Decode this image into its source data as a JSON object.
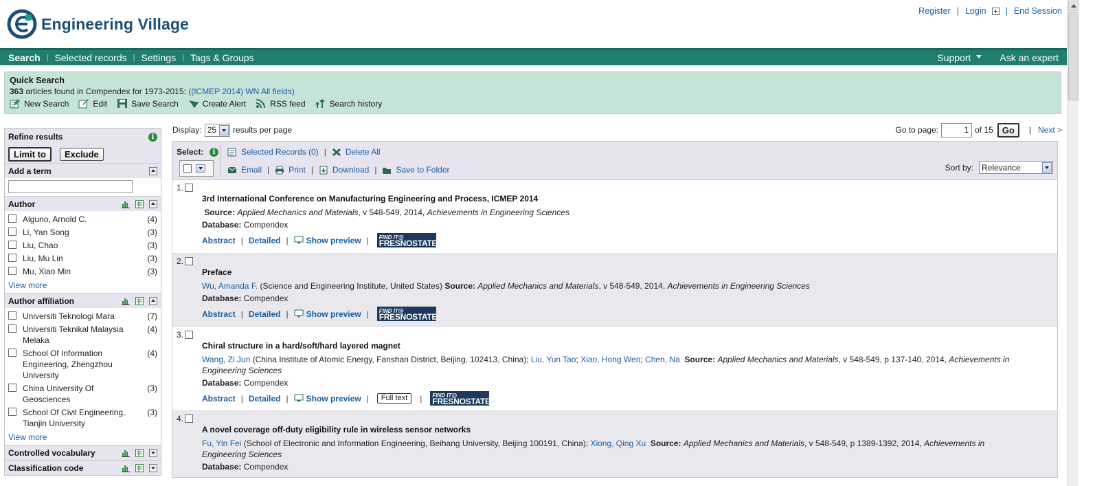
{
  "brand": {
    "name": "Engineering Village",
    "color": "#1c4f78",
    "nav_color": "#1f7e6e"
  },
  "top_links": {
    "register": "Register",
    "login": "Login",
    "end_session": "End Session"
  },
  "nav": {
    "items": [
      "Search",
      "Selected records",
      "Settings",
      "Tags & Groups"
    ],
    "support": "Support",
    "ask": "Ask an expert"
  },
  "quick_search": {
    "title": "Quick Search",
    "count": "363",
    "summary": "articles found in Compendex for 1973-2015:",
    "query": "((ICMEP 2014) WN All fields)",
    "actions": [
      "New Search",
      "Edit",
      "Save Search",
      "Create Alert",
      "RSS feed",
      "Search history"
    ]
  },
  "display": {
    "label": "Display:",
    "value": "25",
    "suffix": "results per page",
    "goto_label": "Go to page:",
    "page": "1",
    "of": "of 15",
    "go": "Go",
    "next": "Next >"
  },
  "sidebar": {
    "refine": "Refine results",
    "limit": "Limit to",
    "exclude": "Exclude",
    "add_term": "Add a term",
    "view_more": "View more",
    "author": {
      "title": "Author",
      "items": [
        {
          "label": "Alguno, Arnold C.",
          "count": "(4)"
        },
        {
          "label": "Li, Yan Song",
          "count": "(3)"
        },
        {
          "label": "Liu, Chao",
          "count": "(3)"
        },
        {
          "label": "Liu, Mu Lin",
          "count": "(3)"
        },
        {
          "label": "Mu, Xiao Min",
          "count": "(3)"
        }
      ]
    },
    "affiliation": {
      "title": "Author affiliation",
      "items": [
        {
          "label": "Universiti Teknologi Mara",
          "count": "(7)"
        },
        {
          "label": "Universiti Teknikal Malaysia Melaka",
          "count": "(4)"
        },
        {
          "label": "School Of Information Engineering, Zhengzhou University",
          "count": "(4)"
        },
        {
          "label": "China University Of Geosciences",
          "count": "(3)"
        },
        {
          "label": "School Of Civil Engineering, Tianjin University",
          "count": "(3)"
        }
      ]
    },
    "controlled": "Controlled vocabulary",
    "classification": "Classification code"
  },
  "toolbar": {
    "select": "Select:",
    "selected_records": "Selected Records (0)",
    "delete_all": "Delete All",
    "email": "Email",
    "print": "Print",
    "download": "Download",
    "save_folder": "Save to Folder",
    "sort_label": "Sort by:",
    "sort_value": "Relevance"
  },
  "results": [
    {
      "num": "1.",
      "title": "3rd International Conference on Manufacturing Engineering and Process, ICMEP 2014",
      "authors": "",
      "affil": "",
      "source": "Applied Mechanics and Materials",
      "source_rest": ", v 548-549, 2014,",
      "series": "Achievements in Engineering Sciences",
      "db": "Compendex",
      "fulltext": ""
    },
    {
      "num": "2.",
      "title": "Preface",
      "authors": "Wu, Amanda F.",
      "affil": " (Science and Engineering Institute, United States) ",
      "source": "Applied Mechanics and Materials",
      "source_rest": ", v 548-549, 2014,",
      "series": "Achievements in Engineering Sciences",
      "db": "Compendex",
      "fulltext": ""
    },
    {
      "num": "3.",
      "title": "Chiral structure in a hard/soft/hard layered magnet",
      "authors": "Wang, Zi Jun",
      "affil": " (China Institute of Atomic Energy, Fanshan District, Beijing, 102413, China); ",
      "coauthors": [
        "Liu, Yun Tao",
        "Xiao, Hong Wen",
        "Chen, Na"
      ],
      "source": "Applied Mechanics and Materials",
      "source_rest": ", v 548-549, p 137-140, 2014,",
      "series": "Achievements in Engineering Sciences",
      "db": "Compendex",
      "fulltext": "Full text"
    },
    {
      "num": "4.",
      "title": "A novel coverage off-duty eligibility rule in wireless sensor networks",
      "authors": "Fu, Yin Fei",
      "affil": " (School of Electronic and Information Engineering, Beihang University, Beijing 100191, China); ",
      "coauthors": [
        "Xiong, Qing Xu"
      ],
      "source": "Applied Mechanics and Materials",
      "source_rest": ", v 548-549, p 1389-1392, 2014,",
      "series": "Achievements in Engineering Sciences",
      "db": "Compendex",
      "fulltext": ""
    }
  ],
  "result_labels": {
    "source": "Source:",
    "database": "Database:",
    "abstract": "Abstract",
    "detailed": "Detailed",
    "preview": "Show preview",
    "findit_top": "FIND IT@",
    "findit_bottom": "FRESNOSTATE"
  }
}
